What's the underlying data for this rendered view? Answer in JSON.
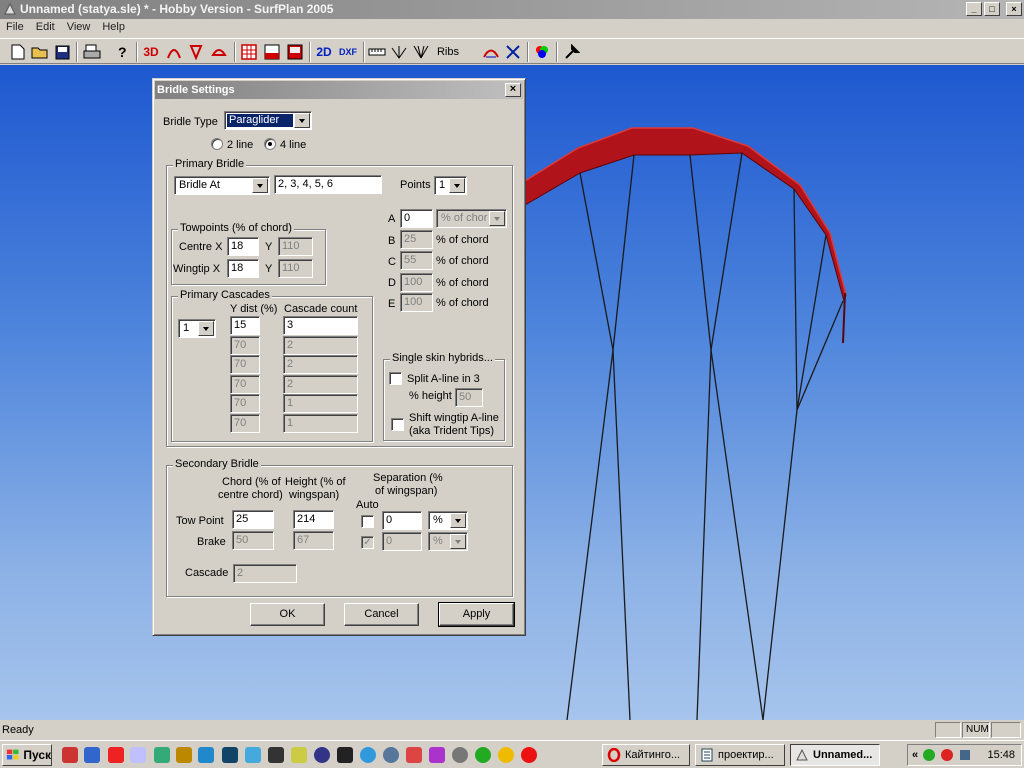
{
  "window": {
    "title": "Unnamed (statya.sle) * - Hobby Version - SurfPlan 2005",
    "controls": [
      "_",
      "□",
      "×"
    ]
  },
  "menu": [
    "File",
    "Edit",
    "View",
    "Help"
  ],
  "toolbar": {
    "label_3d": "3D",
    "label_2d": "2D",
    "label_dxf": "DXF",
    "label_ribs": "Ribs",
    "icons": [
      "new-icon",
      "open-icon",
      "save-icon",
      "print-icon",
      "help-icon",
      "view-3d-icon",
      "arc-icon",
      "profile-icon",
      "shape-icon",
      "grid-icon",
      "panel-icon",
      "image-icon",
      "view-2d-icon",
      "dxf-icon",
      "ruler-icon",
      "bridle-icon",
      "lines-icon",
      "ribs-icon",
      "arch-icon",
      "scissors-icon",
      "color-icon",
      "tools-icon"
    ]
  },
  "colors": {
    "kite_red": "#b0141a",
    "sky_top": "#1e58d0",
    "sky_bottom": "#a6c4ec",
    "title_active": "#0a246a"
  },
  "dialog": {
    "title": "Bridle Settings",
    "close": "×",
    "bridle_type_label": "Bridle Type",
    "bridle_type_value": "Paraglider",
    "radio_2line": "2 line",
    "radio_4line": "4 line",
    "selected_lines": "4 line",
    "primary": {
      "group_label": "Primary Bridle",
      "bridle_at_value": "Bridle At",
      "bridle_at_list": "2, 3, 4, 5, 6",
      "points_label": "Points",
      "points_value": "1",
      "towpoints": {
        "group_label": "Towpoints (% of chord)",
        "centre_label": "Centre X",
        "centre_x": "18",
        "centre_y": "110",
        "wingtip_label": "Wingtip X",
        "wingtip_x": "18",
        "wingtip_y": "110",
        "y_label": "Y"
      },
      "points": [
        {
          "label": "A",
          "value": "0",
          "unit": "% of chord"
        },
        {
          "label": "B",
          "value": "25",
          "unit": "% of chord"
        },
        {
          "label": "C",
          "value": "55",
          "unit": "% of chord"
        },
        {
          "label": "D",
          "value": "100",
          "unit": "% of chord"
        },
        {
          "label": "E",
          "value": "100",
          "unit": "% of chord"
        }
      ],
      "cascades": {
        "group_label": "Primary Cascades",
        "selector": "1",
        "ydist_header": "Y dist (%)",
        "count_header": "Cascade count",
        "rows": [
          {
            "ydist": "15",
            "count": "3"
          },
          {
            "ydist": "70",
            "count": "2"
          },
          {
            "ydist": "70",
            "count": "2"
          },
          {
            "ydist": "70",
            "count": "2"
          },
          {
            "ydist": "70",
            "count": "1"
          },
          {
            "ydist": "70",
            "count": "1"
          }
        ]
      },
      "hybrids": {
        "group_label": "Single skin hybrids...",
        "split_label": "Split A-line in 3",
        "height_label": "% height",
        "height_value": "50",
        "shift_label_1": "Shift wingtip A-line",
        "shift_label_2": "(aka Trident Tips)"
      }
    },
    "secondary": {
      "group_label": "Secondary Bridle",
      "chord_header_1": "Chord (% of",
      "chord_header_2": "centre chord)",
      "height_header_1": "Height (% of",
      "height_header_2": "wingspan)",
      "sep_header_1": "Separation (%",
      "sep_header_2": "of wingspan)",
      "auto_label": "Auto",
      "tow_label": "Tow Point",
      "tow_chord": "25",
      "tow_height": "214",
      "tow_sep": "0",
      "tow_unit": "%",
      "brake_label": "Brake",
      "brake_chord": "50",
      "brake_height": "67",
      "brake_sep": "0",
      "brake_unit": "%",
      "brake_auto_check": "✓",
      "cascade_label": "Cascade",
      "cascade_value": "2"
    },
    "buttons": {
      "ok": "OK",
      "cancel": "Cancel",
      "apply": "Apply"
    }
  },
  "status": {
    "text": "Ready",
    "num": "NUM"
  },
  "taskbar": {
    "start": "Пуск",
    "tasks": [
      {
        "label": "Кайтинго...",
        "icon": "opera-icon"
      },
      {
        "label": "проектир...",
        "icon": "document-icon"
      },
      {
        "label": "Unnamed...",
        "icon": "surfplan-icon"
      }
    ],
    "tray_chevron": "«",
    "clock": "15:48"
  }
}
